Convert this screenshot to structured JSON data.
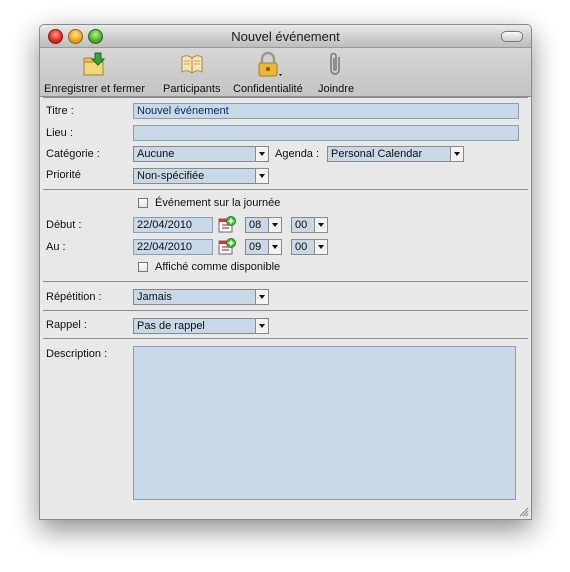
{
  "window": {
    "title": "Nouvel événement"
  },
  "toolbar": {
    "items": [
      {
        "label": "Enregistrer et fermer",
        "icon": "save-close-icon"
      },
      {
        "label": "Participants",
        "icon": "participants-icon"
      },
      {
        "label": "Confidentialité",
        "icon": "lock-icon"
      },
      {
        "label": "Joindre",
        "icon": "paperclip-icon"
      }
    ]
  },
  "form": {
    "title": {
      "label": "Titre :",
      "value": "Nouvel événement"
    },
    "location": {
      "label": "Lieu :",
      "value": ""
    },
    "category": {
      "label": "Catégorie :",
      "value": "Aucune"
    },
    "agenda": {
      "label": "Agenda :",
      "value": "Personal Calendar"
    },
    "priority": {
      "label": "Priorité",
      "value": "Non-spécifiée"
    },
    "all_day": {
      "label": "Événement sur la journée",
      "checked": false
    },
    "start": {
      "label": "Début :",
      "date": "22/04/2010",
      "hour": "08",
      "minute": "00"
    },
    "end": {
      "label": "Au :",
      "date": "22/04/2010",
      "hour": "09",
      "minute": "00"
    },
    "show_free": {
      "label": "Affiché comme disponible",
      "checked": false
    },
    "repeat": {
      "label": "Répétition :",
      "value": "Jamais"
    },
    "reminder": {
      "label": "Rappel :",
      "value": "Pas de rappel"
    },
    "description": {
      "label": "Description :",
      "value": ""
    }
  },
  "colors": {
    "field_bg": "#c9d8e6",
    "window_bg": "#e8e8e8"
  }
}
